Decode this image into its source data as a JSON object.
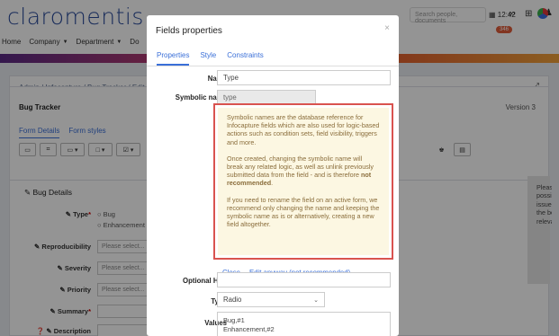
{
  "app": {
    "logo": "claromentis",
    "nav": [
      "Home",
      "Company",
      "Department",
      "Do"
    ],
    "search_placeholder": "Search people, documents",
    "clock": "12:42",
    "badge": "346"
  },
  "breadcrumb": "Admin / Infocapture / Bug Tracker / Edit",
  "tracker": {
    "title": "Bug Tracker",
    "version": "Version 3",
    "tabs": [
      "Form Details",
      "Form styles"
    ]
  },
  "bug_details": {
    "title": "Bug Details",
    "fields": [
      {
        "label": "Type",
        "required": true,
        "kind": "radio",
        "options": [
          "Bug",
          "Enhancement"
        ]
      },
      {
        "label": "Reproducibility",
        "required": false,
        "kind": "select",
        "placeholder": "Please select..."
      },
      {
        "label": "Severity",
        "required": false,
        "kind": "select",
        "placeholder": "Please select..."
      },
      {
        "label": "Priority",
        "required": false,
        "kind": "select",
        "placeholder": "Please select..."
      },
      {
        "label": "Summary",
        "required": true,
        "kind": "text",
        "placeholder": ""
      },
      {
        "label": "Description",
        "required": false,
        "kind": "text",
        "placeholder": ""
      }
    ],
    "help": "Please provide as much information as possible, including steps to replicate the issue. Please use the file upload facility at the bottom of the form to attach any relevant files or screenshots."
  },
  "modal": {
    "title": "Fields properties",
    "close": "×",
    "tabs": [
      "Properties",
      "Style",
      "Constraints"
    ],
    "name_label": "Name",
    "name_value": "Type",
    "symbolic_label": "Symbolic name",
    "symbolic_value": "type",
    "warning_p1": "Symbolic names are the database reference for Infocapture fields which are also used for logic-based actions such as condition sets, field visibility, triggers and more.",
    "warning_p2_a": "Once created, changing the symbolic name will break any related logic, as well as unlink previously submitted data from the field - and is therefore ",
    "warning_p2_b": "not recommended",
    "warning_p2_c": ".",
    "warning_p3": "If you need to rename the field on an active form, we recommend only changing the name and keeping the symbolic name as is or alternatively, creating a new field altogether.",
    "close_link": "Close",
    "edit_anyway_link": "Edit anyway (not recommended)",
    "hint_label": "Optional Hint",
    "hint_value": "",
    "type_label": "Type",
    "type_value": "Radio",
    "values_label": "Values",
    "values_lines": [
      "Bug,#1",
      "Enhancement,#2"
    ]
  }
}
